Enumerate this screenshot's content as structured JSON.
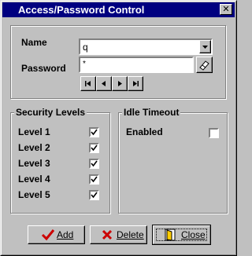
{
  "window": {
    "title": "Access/Password Control",
    "close_glyph": "✕"
  },
  "form": {
    "name_label": "Name",
    "name_value": "q",
    "password_label": "Password",
    "password_value": "*",
    "navigator": [
      "first-record-icon",
      "previous-record-icon",
      "next-record-icon",
      "last-record-icon"
    ]
  },
  "security": {
    "title": "Security Levels",
    "levels": [
      {
        "label": "Level 1",
        "checked": true
      },
      {
        "label": "Level 2",
        "checked": true
      },
      {
        "label": "Level 3",
        "checked": true
      },
      {
        "label": "Level 4",
        "checked": true
      },
      {
        "label": "Level 5",
        "checked": true
      }
    ]
  },
  "idle": {
    "title": "Idle Timeout",
    "enabled_label": "Enabled",
    "enabled_checked": false
  },
  "buttons": {
    "add": "Add",
    "delete": "Delete",
    "close": "Close"
  },
  "colors": {
    "titlebar": "#000080",
    "face": "#c0c0c0",
    "add_icon": "#cc0000",
    "delete_icon": "#cc0000",
    "close_door": "#ffcc00"
  }
}
